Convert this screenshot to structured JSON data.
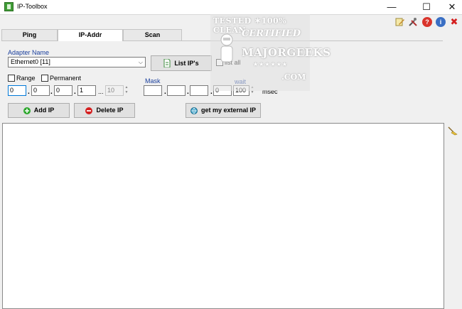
{
  "window": {
    "title": "IP-Toolbox",
    "minimize": "—",
    "maximize": "☐",
    "close": "✕"
  },
  "toolbar": {
    "icons": [
      "edit-icon",
      "settings-icon",
      "help-icon",
      "info-icon",
      "exit-icon"
    ],
    "help_glyph": "?",
    "info_glyph": "i",
    "exit_glyph": "✖"
  },
  "tabs": [
    {
      "label": "Ping",
      "active": false
    },
    {
      "label": "IP-Addr",
      "active": true
    },
    {
      "label": "Scan",
      "active": false
    }
  ],
  "ipaddr": {
    "adapter_label": "Adapter Name",
    "adapter_value": "Ethernet0 [11]",
    "list_ips_button": "List IP's",
    "list_all_label": "list all",
    "list_all_checked": false,
    "range_label": "Range",
    "range_checked": false,
    "permanent_label": "Permanent",
    "permanent_checked": false,
    "ip_octets": [
      "0",
      "0",
      "0",
      "1"
    ],
    "range_ellipsis": "...",
    "range_end": "10",
    "mask_label": "Mask",
    "mask_octets": [
      "",
      "",
      "",
      "0"
    ],
    "wait_label": "wait",
    "wait_value": "100",
    "wait_unit": "msec",
    "add_ip_button": "Add IP",
    "delete_ip_button": "Delete IP",
    "external_ip_button": "get my external IP"
  },
  "watermark": {
    "line1": "TESTED ✶100% CLEAN",
    "line2": "CERTIFIED",
    "line3": "MAJORGEEKS",
    "line4": "★★★★★★",
    "line5": ".COM"
  },
  "colors": {
    "accent_blue": "#1a3f9c",
    "add_green": "#2fa82f",
    "delete_red": "#d42020",
    "help_red": "#d9342b",
    "info_blue": "#3a6fc4"
  }
}
